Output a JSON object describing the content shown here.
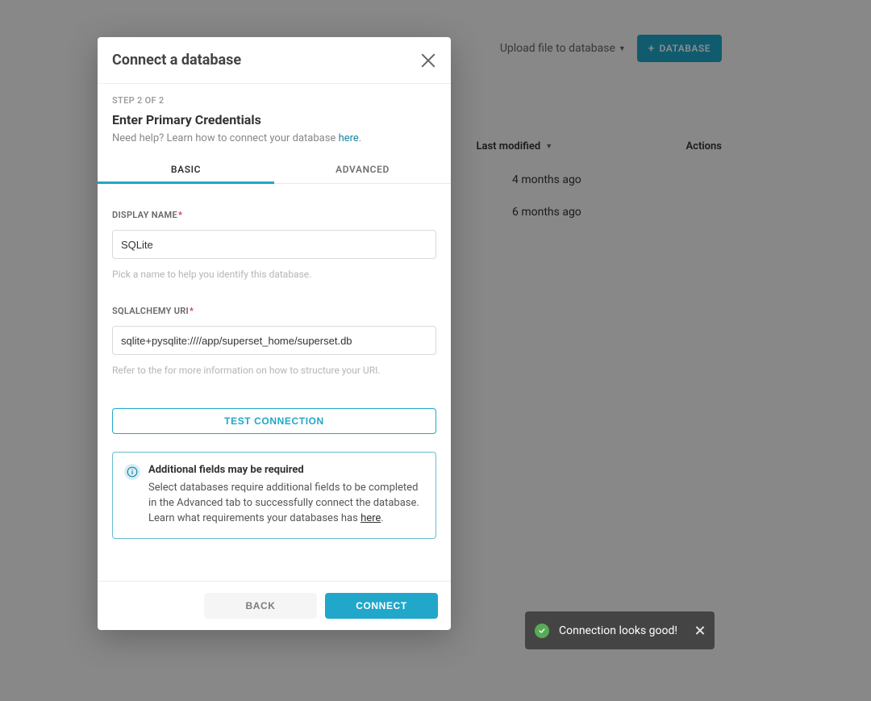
{
  "header": {
    "upload_label": "Upload file to database",
    "add_database_label": "DATABASE"
  },
  "list": {
    "columns": {
      "last_modified": "Last modified",
      "actions": "Actions"
    },
    "rows": [
      {
        "last_modified": "4 months ago"
      },
      {
        "last_modified": "6 months ago"
      }
    ]
  },
  "modal": {
    "title": "Connect a database",
    "step_label": "STEP 2 OF 2",
    "credentials_title": "Enter Primary Credentials",
    "help_prefix": "Need help? Learn how to connect your database ",
    "help_link": "here",
    "help_suffix": ".",
    "tabs": {
      "basic": "BASIC",
      "advanced": "ADVANCED"
    },
    "fields": {
      "display_name": {
        "label": "DISPLAY NAME",
        "value": "SQLite",
        "hint": "Pick a name to help you identify this database."
      },
      "sqlalchemy_uri": {
        "label": "SQLALCHEMY URI",
        "value": "sqlite+pysqlite:////app/superset_home/superset.db",
        "hint": "Refer to the for more information on how to structure your URI."
      }
    },
    "test_connection_label": "TEST CONNECTION",
    "info": {
      "title": "Additional fields may be required",
      "body_prefix": "Select databases require additional fields to be completed in the Advanced tab to successfully connect the database. Learn what requirements your databases has ",
      "body_link": "here",
      "body_suffix": "."
    },
    "footer": {
      "back": "BACK",
      "connect": "CONNECT"
    }
  },
  "toast": {
    "message": "Connection looks good!"
  }
}
